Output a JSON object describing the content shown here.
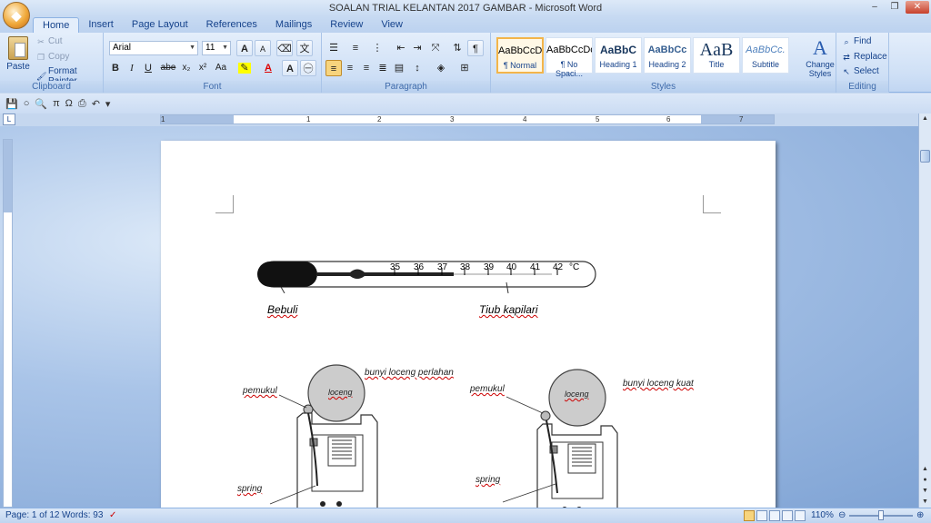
{
  "window": {
    "title": "SOALAN TRIAL KELANTAN 2017 GAMBAR - Microsoft Word",
    "controls": {
      "minimize": "–",
      "restore": "❐",
      "close": "✕"
    }
  },
  "tabs": [
    "Home",
    "Insert",
    "Page Layout",
    "References",
    "Mailings",
    "Review",
    "View"
  ],
  "active_tab": "Home",
  "clipboard": {
    "paste": "Paste",
    "cut": "Cut",
    "copy": "Copy",
    "format_painter": "Format Painter",
    "group_label": "Clipboard"
  },
  "font": {
    "name": "Arial",
    "size": "11",
    "group_label": "Font",
    "bold": "B",
    "italic": "I",
    "underline": "U",
    "strike": "abe",
    "sub": "x₂",
    "sup": "x²",
    "case": "Aa",
    "grow": "A",
    "shrink": "A"
  },
  "paragraph": {
    "group_label": "Paragraph"
  },
  "styles": {
    "group_label": "Styles",
    "items": [
      {
        "sample": "AaBbCcDc",
        "name": "¶ Normal"
      },
      {
        "sample": "AaBbCcDc",
        "name": "¶ No Spaci..."
      },
      {
        "sample": "AaBbC",
        "name": "Heading 1"
      },
      {
        "sample": "AaBbCc",
        "name": "Heading 2"
      },
      {
        "sample": "AaB",
        "name": "Title"
      },
      {
        "sample": "AaBbCc.",
        "name": "Subtitle"
      }
    ],
    "change_styles_line1": "Change",
    "change_styles_line2": "Styles"
  },
  "editing": {
    "find": "Find",
    "replace": "Replace",
    "select": "Select",
    "group_label": "Editing"
  },
  "ruler": {
    "numbers": [
      "1",
      "1",
      "2",
      "3",
      "4",
      "5",
      "6",
      "7"
    ]
  },
  "document": {
    "thermometer_scale": [
      "35",
      "36",
      "37",
      "38",
      "39",
      "40",
      "41",
      "42",
      "°C"
    ],
    "label_bulb": "Bebuli",
    "label_capillary": "Tiub kapilari",
    "bell_left": {
      "striker": "pemukul",
      "bell": "loceng",
      "sound": "bunyi loceng perlahan",
      "spring": "spring"
    },
    "bell_right": {
      "striker": "pemukul",
      "bell": "loceng",
      "sound": "bunyi loceng kuat",
      "spring": "spring"
    }
  },
  "status": {
    "page": "Page: 1 of 12",
    "words": "Words: 93",
    "zoom": "110%"
  }
}
